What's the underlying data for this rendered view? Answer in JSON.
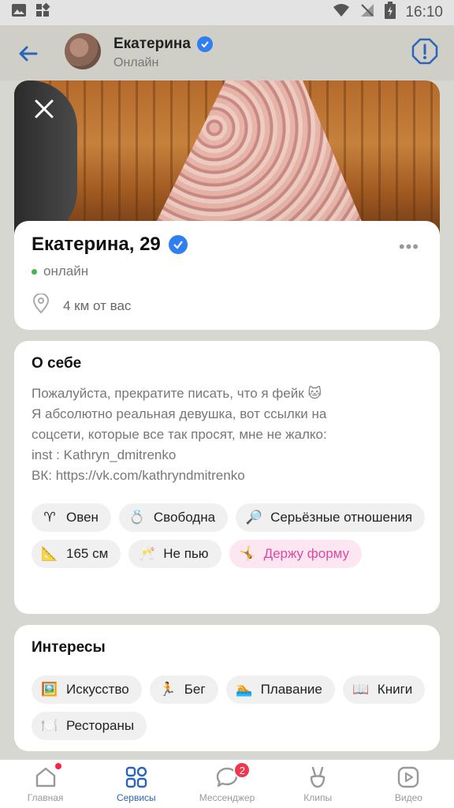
{
  "status_bar": {
    "time": "16:10"
  },
  "header": {
    "name": "Екатерина",
    "status": "Онлайн"
  },
  "profile": {
    "name_age": "Екатерина, 29",
    "online": "онлайн",
    "distance": "4 км от вас",
    "more": "•••"
  },
  "about": {
    "title": "О себе",
    "lines": [
      "Пожалуйста, прекратите писать, что я фейк 🐱",
      "Я абсолютно реальная девушка, вот ссылки на",
      "соцсети, которые все так просят, мне не жалко:",
      "inst : Kathryn_dmitrenko",
      "ВК: https://vk.com/kathryndmitrenko"
    ],
    "tags": [
      {
        "icon": "♈",
        "label": "Овен"
      },
      {
        "icon": "💍",
        "label": "Свободна"
      },
      {
        "icon": "🔎",
        "label": "Серьёзные отношения"
      },
      {
        "icon": "📐",
        "label": "165 см"
      },
      {
        "icon": "🥂",
        "label": "Не пью"
      },
      {
        "icon": "🤸",
        "label": "Держу форму",
        "highlight": true
      }
    ]
  },
  "interests": {
    "title": "Интересы",
    "tags": [
      {
        "icon": "🖼️",
        "label": "Искусство"
      },
      {
        "icon": "🏃",
        "label": "Бег"
      },
      {
        "icon": "🏊",
        "label": "Плавание"
      },
      {
        "icon": "📖",
        "label": "Книги"
      },
      {
        "icon": "🍽️",
        "label": "Рестораны"
      }
    ]
  },
  "nav": {
    "items": [
      {
        "label": "Главная",
        "icon": "home-icon"
      },
      {
        "label": "Сервисы",
        "icon": "services-icon",
        "active": true
      },
      {
        "label": "Мессенджер",
        "icon": "messenger-icon",
        "badge": "2"
      },
      {
        "label": "Клипы",
        "icon": "clips-icon"
      },
      {
        "label": "Видео",
        "icon": "video-icon"
      }
    ]
  }
}
